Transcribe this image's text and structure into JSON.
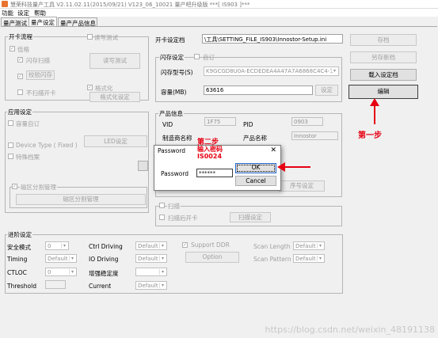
{
  "window": {
    "title": "慧荣科技量产工具 V2.11.02.11(2015/09/21)   V123_06_10021 量产吧升级版          ***[ IS903 ]***"
  },
  "menu": [
    "功能",
    "设定",
    "帮助"
  ],
  "tabs": [
    "量产测试",
    "量产设定",
    "量产产品信息"
  ],
  "card_flow": {
    "title": "开卡流程",
    "low_format": "低格",
    "flash_scan": "闪存扫描",
    "verify_flash": "校验闪存",
    "no_reopen": "不扫描开卡",
    "read_test": "读写测试",
    "read_test_btn": "读写测试",
    "format": "格式化",
    "format_btn": "格式化设定"
  },
  "app_settings": {
    "title": "应用设定",
    "capacity_fixed": "容量自订",
    "device_type": "Device Type ( Fixed )",
    "special_files": "特殊档案",
    "led_btn": "LED设定",
    "partition_mgmt": "磁区分割管理",
    "partition_btn": "磁区分割管理"
  },
  "card_settings": {
    "title": "开卡设定档",
    "path": "\\工具\\SETTING_FILE_IS903\\Innostor-Setup.ini",
    "flash_settings": "闪存设定",
    "custom": "自订",
    "flash_model_label": "闪存型号(S)",
    "flash_model_value": "K9GCGD8U0A-ECDEDEA4A47A7A6868C4C4-1",
    "capacity_label": "容量(MB)",
    "capacity_value": "63616",
    "settings_btn": "设定"
  },
  "right_buttons": {
    "save": "存档",
    "save_as": "另存新档",
    "load": "载入设定档",
    "edit": "编辑"
  },
  "product_info": {
    "title": "产品信息",
    "vid_label": "VID",
    "vid_value": "1F75",
    "pid_label": "PID",
    "pid_value": "0903",
    "maker_label": "制造商名称",
    "product_label": "产品名称",
    "product_value": "Innostor",
    "serial_btn": "序号设定"
  },
  "scan": {
    "title": "扫描",
    "after_scan": "扫描后开卡",
    "scan_btn": "扫描设定"
  },
  "advanced": {
    "title": "进阶设定",
    "safe_mode": "安全模式",
    "safe_mode_value": "0",
    "ctrl_driving": "Ctrl Driving",
    "ctrl_value": "Default",
    "flash_driving": "Flash Driving",
    "flash_driving_value": "Default",
    "support_ddr": "Support DDR",
    "scan_length": "Scan Length",
    "scan_length_value": "Default",
    "timing": "Timing",
    "timing_value": "Default",
    "io_driving": "IO Driving",
    "io_value": "Default",
    "option_btn": "Option",
    "scan_pattern": "Scan Pattern",
    "scan_pattern_value": "Default",
    "ctloc": "CTLOC",
    "ctloc_value": "0",
    "boost": "增强稳定度",
    "threshold": "Threshold",
    "current": "Current",
    "current_value": "Default"
  },
  "dialog": {
    "title": "Password",
    "password_label": "Password",
    "password_value": "******",
    "ok": "OK",
    "cancel": "Cancel"
  },
  "annotations": {
    "step1": "第一步",
    "step2": "第二步",
    "hint": "输入密码",
    "code": "IS0024"
  },
  "watermark": "https://blog.csdn.net/weixin_48191138",
  "colors": {
    "annotation_red": "#e60012",
    "dialog_border": "#7a7a7a"
  }
}
